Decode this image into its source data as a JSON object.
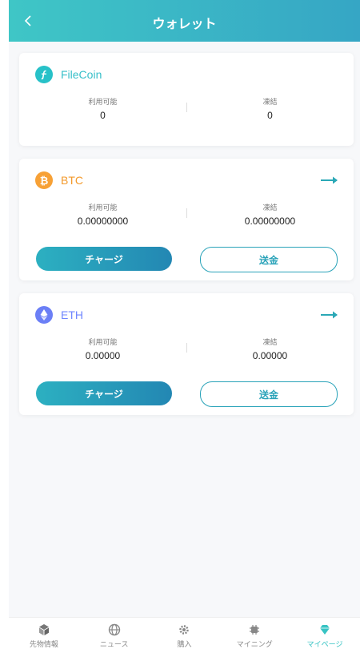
{
  "header": {
    "title": "ウォレット"
  },
  "wallets": [
    {
      "name": "FileCoin",
      "name_color": "#37bfc9",
      "icon": "filecoin-icon",
      "icon_bg": "#27c1c8",
      "available_label": "利用可能",
      "available_value": "0",
      "frozen_label": "凍結",
      "frozen_value": "0"
    },
    {
      "name": "BTC",
      "name_color": "#f39a2c",
      "icon": "bitcoin-icon",
      "icon_bg": "#f7a136",
      "available_label": "利用可能",
      "available_value": "0.00000000",
      "frozen_label": "凍結",
      "frozen_value": "0.00000000",
      "charge_label": "チャージ",
      "send_label": "送金"
    },
    {
      "name": "ETH",
      "name_color": "#6f86ff",
      "icon": "ethereum-icon",
      "icon_bg": "#6b7ff6",
      "available_label": "利用可能",
      "available_value": "0.00000",
      "frozen_label": "凍結",
      "frozen_value": "0.00000",
      "charge_label": "チャージ",
      "send_label": "送金"
    }
  ],
  "tabbar": {
    "items": [
      {
        "label": "先物情報",
        "icon": "cube-icon"
      },
      {
        "label": "ニュース",
        "icon": "globe-icon"
      },
      {
        "label": "購入",
        "icon": "gear-icon"
      },
      {
        "label": "マイニング",
        "icon": "chip-icon"
      },
      {
        "label": "マイページ",
        "icon": "diamond-icon",
        "active": true
      }
    ]
  },
  "colors": {
    "accent": "#37c3c3",
    "button_gradient_start": "#2cb0c1",
    "button_gradient_end": "#2387b3"
  }
}
